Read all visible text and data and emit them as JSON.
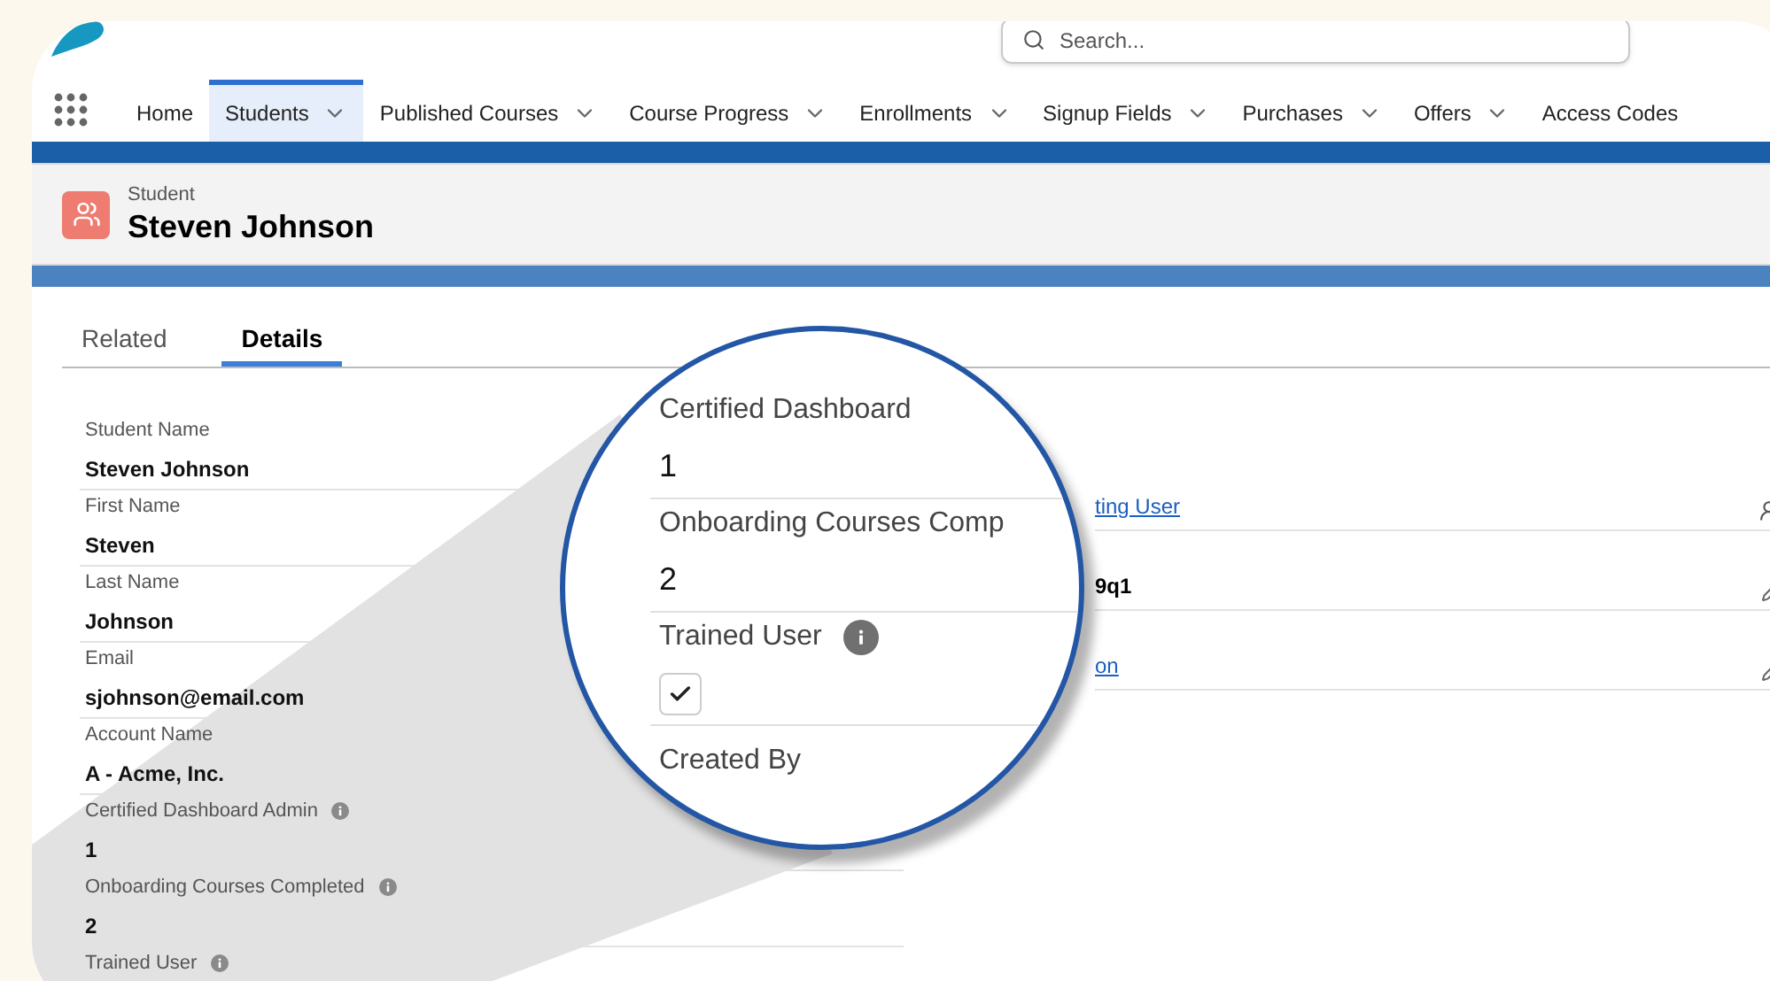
{
  "search": {
    "placeholder": "Search..."
  },
  "nav_tabs": [
    {
      "label": "Home",
      "dropdown": false,
      "selected": false
    },
    {
      "label": "Students",
      "dropdown": true,
      "selected": true
    },
    {
      "label": "Published Courses",
      "dropdown": true,
      "selected": false
    },
    {
      "label": "Course Progress",
      "dropdown": true,
      "selected": false
    },
    {
      "label": "Enrollments",
      "dropdown": true,
      "selected": false
    },
    {
      "label": "Signup Fields",
      "dropdown": true,
      "selected": false
    },
    {
      "label": "Purchases",
      "dropdown": true,
      "selected": false
    },
    {
      "label": "Offers",
      "dropdown": true,
      "selected": false
    },
    {
      "label": "Access Codes",
      "dropdown": false,
      "selected": false
    }
  ],
  "record": {
    "object": "Student",
    "name": "Steven Johnson"
  },
  "record_tabs": [
    {
      "label": "Related",
      "selected": false
    },
    {
      "label": "Details",
      "selected": true
    }
  ],
  "fields": [
    {
      "label": "Student Name",
      "value": "Steven Johnson",
      "info": false
    },
    {
      "label": "First Name",
      "value": "Steven",
      "info": false
    },
    {
      "label": "Last Name",
      "value": "Johnson",
      "info": false
    },
    {
      "label": "Email",
      "value": "sjohnson@email.com",
      "info": false
    },
    {
      "label": "Account Name",
      "value": "A - Acme, Inc.",
      "info": false
    },
    {
      "label": "Certified Dashboard Admin",
      "value": "1",
      "info": true
    },
    {
      "label": "Onboarding Courses Completed",
      "value": "2",
      "info": true
    },
    {
      "label": "Trained User",
      "info": true
    }
  ],
  "right_fields": [
    {
      "value": "ting User",
      "kind": "owner",
      "link": true
    },
    {
      "value": "9q1",
      "kind": "edit",
      "link": false
    },
    {
      "value": "on",
      "kind": "edit",
      "link": true
    }
  ],
  "magnifier": {
    "rows": [
      {
        "kind": "text",
        "label": "Certified Dashboard",
        "value": "1",
        "info": false
      },
      {
        "kind": "text",
        "label": "Onboarding Courses Comp",
        "value": "2",
        "info": false
      },
      {
        "kind": "checkbox",
        "label": "Trained User",
        "info": true,
        "checked": true
      },
      {
        "kind": "label",
        "label": "Created By",
        "info": false
      }
    ]
  }
}
